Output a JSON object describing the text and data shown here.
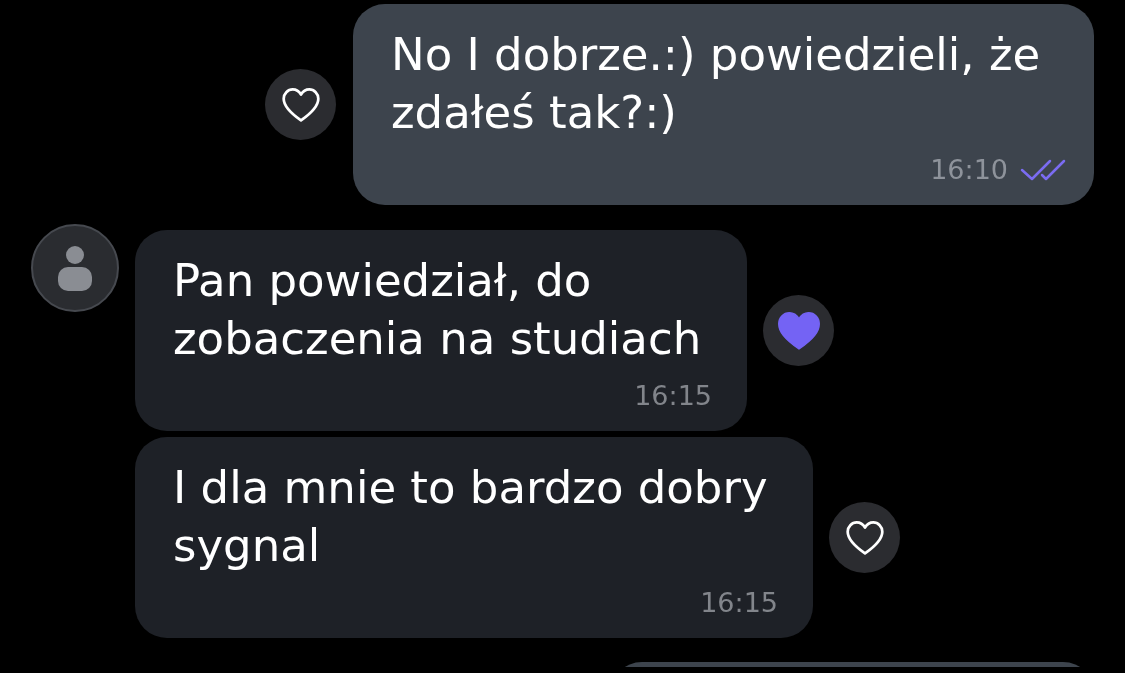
{
  "messages": [
    {
      "kind": "outgoing",
      "text": "No I dobrze.:) powiedzieli, że zdałeś tak?:)",
      "time": "16:10",
      "read": true,
      "liked": false
    },
    {
      "kind": "incoming",
      "show_avatar": true,
      "text": "Pan powiedział, do zobaczenia na studiach",
      "time": "16:15",
      "liked": true
    },
    {
      "kind": "incoming",
      "show_avatar": false,
      "text": "I dla mnie to bardzo dobry sygnal",
      "time": "16:15",
      "liked": false
    },
    {
      "kind": "outgoing_edge"
    }
  ]
}
